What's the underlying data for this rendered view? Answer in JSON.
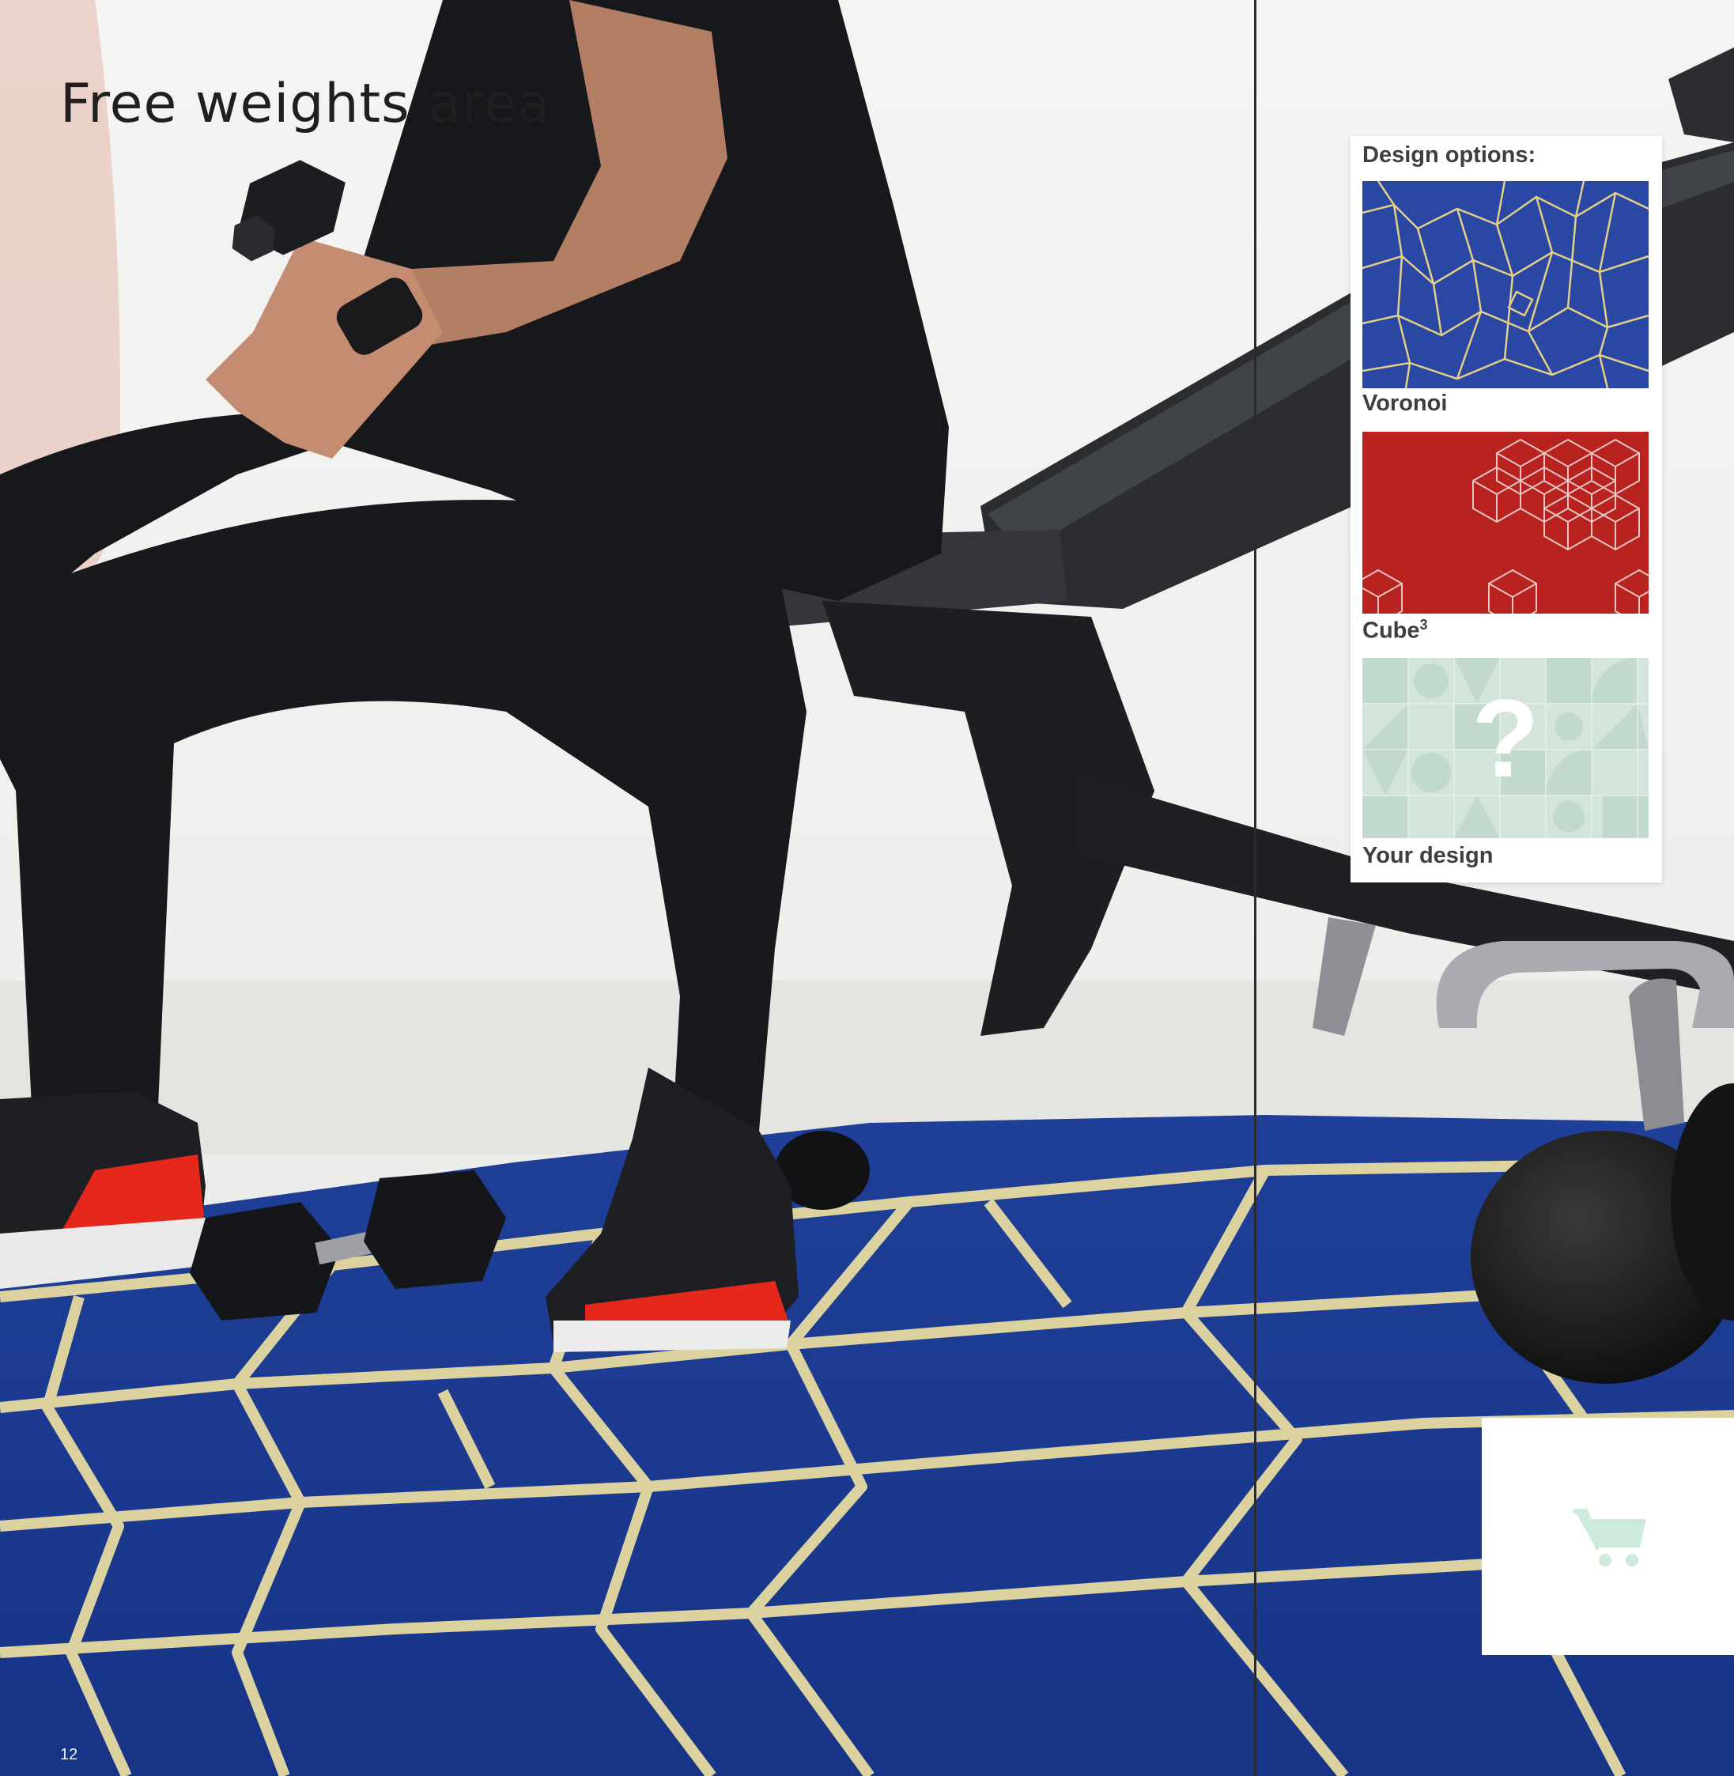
{
  "page": {
    "title": "Free weights area",
    "page_number": "12"
  },
  "design_options": {
    "heading": "Design options:",
    "items": [
      {
        "label": "Voronoi",
        "icon": "voronoi-pattern",
        "color": "#2a47a3"
      },
      {
        "label": "Cube",
        "superscript": "3",
        "icon": "cube-pattern",
        "color": "#b8231f"
      },
      {
        "label": "Your design",
        "icon": "custom-pattern",
        "marker": "?",
        "color": "#d3e5da"
      }
    ]
  },
  "cart": {
    "icon": "cart-icon",
    "color": "#cdeadb"
  },
  "colors": {
    "carpet_blue": "#1e3f95",
    "carpet_lines": "#e9dca3",
    "title_text": "#1f1f1f"
  }
}
